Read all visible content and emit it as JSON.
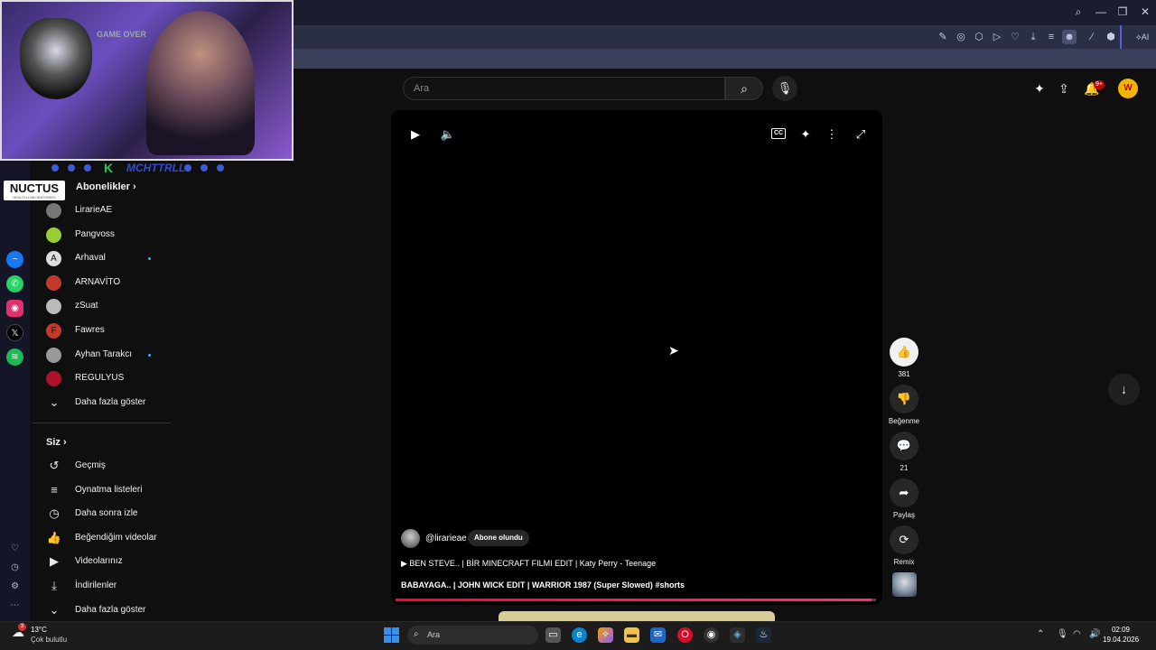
{
  "browser": {
    "title_controls": {
      "search": "⌕",
      "minimize": "—",
      "restore": "❐",
      "close": "✕"
    },
    "toolbar_ai_label": "AI"
  },
  "overlay": {
    "webcam_text": "GAME OVER",
    "channel_tag": "MCHTTRLL",
    "sponsor": "NUCTUS",
    "sponsor_sub": "HEALTH LABORATORIES"
  },
  "sidebar": {
    "subscriptions_header": "Abonelikler",
    "subscriptions": [
      {
        "label": "LirarieAE",
        "icon": "avatar",
        "color": "#777",
        "live": false
      },
      {
        "label": "Pangvoss",
        "icon": "avatar",
        "color": "#9acd32",
        "live": false
      },
      {
        "label": "Arhaval",
        "icon": "A",
        "color": "#ddd",
        "live": true
      },
      {
        "label": "ARNAVİTO",
        "icon": "avatar",
        "color": "#c0392b",
        "live": false
      },
      {
        "label": "zSuat",
        "icon": "avatar",
        "color": "#bbb",
        "live": false
      },
      {
        "label": "Fawres",
        "icon": "F",
        "color": "#c0392b",
        "live": false
      },
      {
        "label": "Ayhan Tarakcı",
        "icon": "avatar",
        "color": "#999",
        "live": true
      },
      {
        "label": "REGULYUS",
        "icon": "avatar",
        "color": "#b0102a",
        "live": false
      }
    ],
    "show_more_label": "Daha fazla göster",
    "you_header": "Siz",
    "you_items": [
      {
        "label": "Geçmiş",
        "icon": "↺"
      },
      {
        "label": "Oynatma listeleri",
        "icon": "≡"
      },
      {
        "label": "Daha sonra izle",
        "icon": "◷"
      },
      {
        "label": "Beğendiğim videolar",
        "icon": "👍"
      },
      {
        "label": "Videolarınız",
        "icon": "▶"
      },
      {
        "label": "İndirilenler",
        "icon": "⤓"
      },
      {
        "label": "Daha fazla göster",
        "icon": "⌄"
      }
    ]
  },
  "header": {
    "search_placeholder": "Ara",
    "notification_count": "9+"
  },
  "player": {
    "channel_handle": "@lirarieae",
    "subscribe_label": "Abone olundu",
    "track_label": "BEN STEVE.. | BİR MINECRAFT FILMI EDIT | Katy Perry - Teenage",
    "video_title": "BABAYAGA.. | JOHN WICK EDIT | WARRIOR 1987 (Super Slowed)",
    "video_hashtag": "#shorts",
    "progress": 0.99
  },
  "actions": {
    "like_count": "381",
    "dislike_label": "Beğenme",
    "comment_count": "21",
    "share_label": "Paylaş",
    "remix_label": "Remix"
  },
  "taskbar": {
    "weather_temp": "13°C",
    "weather_desc": "Çok bulutlu",
    "search_label": "Ara",
    "time": "02:09",
    "date": "19.04.2026",
    "weather_badge": "3"
  },
  "colors": {
    "accent_red": "#ff0033",
    "youtube_bg": "#0f0f0f",
    "browser_chrome": "#2b2f45"
  }
}
